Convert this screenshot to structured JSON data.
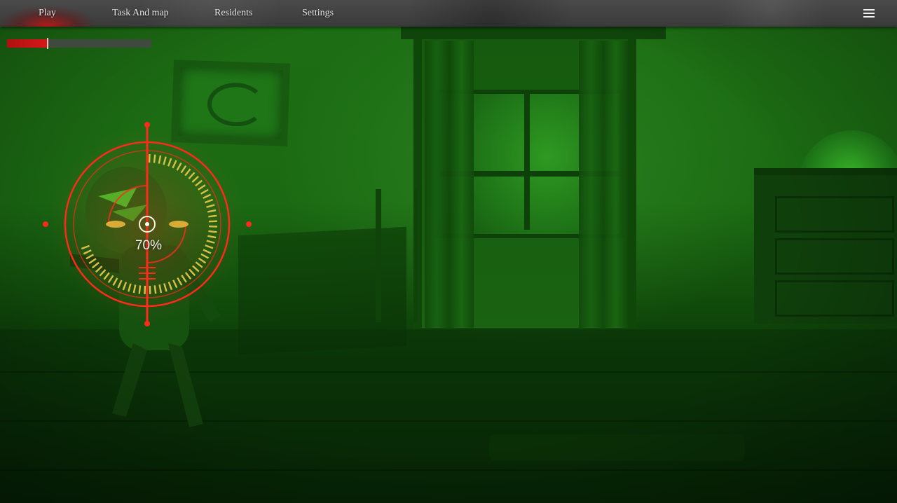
{
  "nav": {
    "items": [
      {
        "label": "Play",
        "active": true
      },
      {
        "label": "Task And map",
        "active": false
      },
      {
        "label": "Residents",
        "active": false
      },
      {
        "label": "Settings",
        "active": false
      }
    ],
    "menu_icon": "hamburger-menu-icon"
  },
  "hud": {
    "progress_fraction": 0.28,
    "reticle_percent_label": "70%",
    "reticle_progress_fraction": 0.7
  },
  "colors": {
    "night_vision_green": "#1d6e14",
    "reticle_red": "#ff2a1a",
    "reticle_ticks": "#d8c04a",
    "active_tab_glow": "#c81414"
  }
}
